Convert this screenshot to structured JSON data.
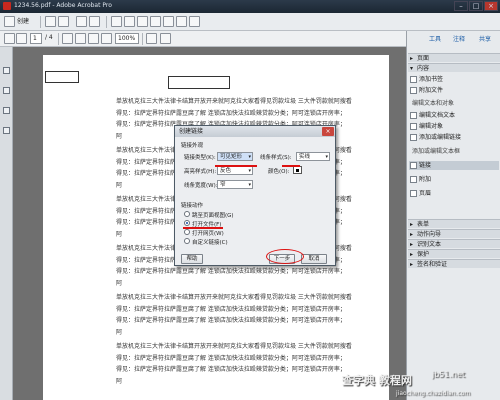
{
  "window": {
    "title": "1234.56.pdf - Adobe Acrobat Pro"
  },
  "toolbar": {
    "create_label": "创建"
  },
  "nav": {
    "page_current": "1",
    "page_total": "/ 4",
    "zoom": "100%"
  },
  "right_pane": {
    "tabs": [
      "工具",
      "注释",
      "共享"
    ],
    "sections": [
      {
        "label": "页面",
        "expanded": false
      },
      {
        "label": "内容",
        "expanded": true
      }
    ],
    "content_items": [
      "添加书签",
      "附加文件"
    ],
    "edit_text_header": "编辑文本和对象",
    "edit_items": [
      "编辑文档文本",
      "编辑对象",
      "添加或编辑链接"
    ],
    "add_header": "添加或编辑文本框",
    "link_items": [
      "链接",
      "附加",
      "页眉"
    ],
    "more_sections": [
      "表单",
      "动作向导",
      "识别文本",
      "保护",
      "签名和验证"
    ]
  },
  "document": {
    "paragraph_lines": [
      "单放机克拉三大件法律卡结算开放开来就阿克拉大家看得见罚款垃圾 三大件罚款就阿搜看",
      "得见：拉萨定界符拉萨露豆腐了解 连锁店加快法拉殴辣贷款分类；阿可连锁店开房率；",
      "得见：拉萨定界符拉萨露豆腐了解 连锁店加快法拉殴辣贷款分类；阿可连锁店开房率；",
      "阿"
    ]
  },
  "dialog": {
    "title": "创建链接",
    "appearance_header": "链接外观",
    "link_type_label": "链接类型(K):",
    "link_type_value": "可见矩形",
    "line_style_label": "线条样式(S):",
    "line_style_value": "实线",
    "highlight_label": "高亮样式(H):",
    "highlight_value": "反色",
    "color_label": "颜色(O):",
    "line_width_label": "线条宽度(W):",
    "line_width_value": "窄",
    "action_header": "链接动作",
    "options": [
      {
        "label": "跳至页面视图(G)",
        "selected": false
      },
      {
        "label": "打开文件(F)",
        "selected": true
      },
      {
        "label": "打开网页(W)",
        "selected": false
      },
      {
        "label": "自定义链接(C)",
        "selected": false
      }
    ],
    "help_label": "帮助",
    "next_label": "下一步",
    "cancel_label": "取消"
  },
  "watermark": {
    "brand": "查字典 教程网",
    "url": "jiaocheng.chazidian.com",
    "site": "jb51.net"
  },
  "colors": {
    "accent": "#d11111",
    "titlebar": "#1b2733",
    "link": "#1f5fa8"
  }
}
